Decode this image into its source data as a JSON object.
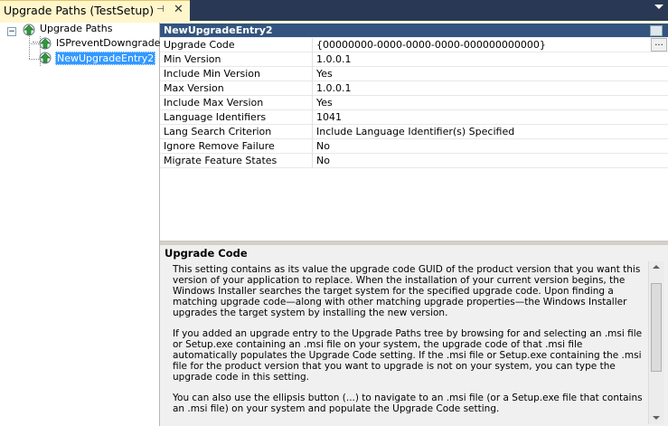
{
  "tab": {
    "title": "Upgrade Paths (TestSetup)",
    "pin_glyph": "⊣",
    "close_glyph": "✕"
  },
  "tree": {
    "root": {
      "label": "Upgrade Paths",
      "expander": "−",
      "icon": "upgrade-arrow-icon"
    },
    "children": [
      {
        "label": "ISPreventDowngrade",
        "icon": "upgrade-arrow-icon"
      },
      {
        "label": "NewUpgradeEntry2",
        "icon": "upgrade-arrow-icon",
        "selected": true
      }
    ]
  },
  "properties": {
    "header": "NewUpgradeEntry2",
    "rows": [
      {
        "name": "Upgrade Code",
        "value": "{00000000-0000-0000-0000-000000000000}",
        "has_ellipsis": true
      },
      {
        "name": "Min Version",
        "value": "1.0.0.1"
      },
      {
        "name": "Include Min Version",
        "value": "Yes"
      },
      {
        "name": "Max Version",
        "value": "1.0.0.1"
      },
      {
        "name": "Include Max Version",
        "value": "Yes"
      },
      {
        "name": "Language Identifiers",
        "value": "1041"
      },
      {
        "name": "Lang Search Criterion",
        "value": "Include Language Identifier(s) Specified"
      },
      {
        "name": "Ignore Remove Failure",
        "value": "No"
      },
      {
        "name": "Migrate Feature States",
        "value": "No"
      }
    ],
    "ellipsis_label": "..."
  },
  "description": {
    "title": "Upgrade Code",
    "paragraphs": [
      "This setting contains as its value the upgrade code GUID of the product version that you want this version of your application to replace. When the installation of your current version begins, the Windows Installer searches the target system for the specified upgrade code. Upon finding a matching upgrade code—along with other matching upgrade properties—the Windows Installer upgrades the target system by installing the new version.",
      "If you added an upgrade entry to the Upgrade Paths tree by browsing for and selecting an .msi file or Setup.exe containing an .msi file on your system, the upgrade code of that .msi file automatically populates the Upgrade Code setting. If the .msi file or Setup.exe containing the .msi file for the product version that you want to upgrade is not on your system, you can type the upgrade code in this setting.",
      "You can also use the ellipsis button (...) to navigate to an .msi file (or a Setup.exe file that contains an .msi file) on your system and populate the Upgrade Code setting."
    ]
  },
  "colors": {
    "tab_bg": "#fff6cc",
    "strip_bg": "#293955",
    "header_bg": "#33547e",
    "selection": "#3399ff"
  }
}
